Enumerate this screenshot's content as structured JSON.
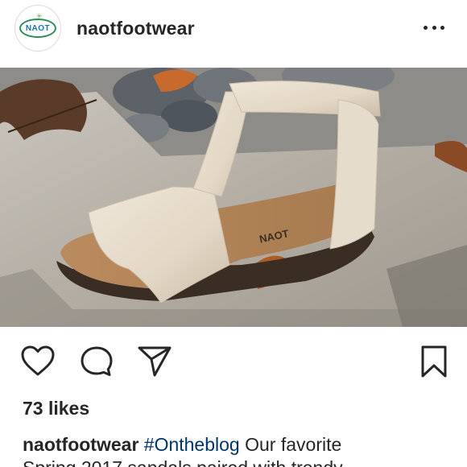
{
  "header": {
    "logo_text": "NAOT",
    "username": "naotfootwear",
    "more_label": "More options"
  },
  "photo": {
    "alt": "Cream leather T-strap sandal on stone",
    "insole_brand_text": "NAOT"
  },
  "actions": {
    "like_icon": "heart-icon",
    "comment_icon": "comment-icon",
    "share_icon": "share-icon",
    "save_icon": "bookmark-icon"
  },
  "likes": {
    "text": "73 likes"
  },
  "caption": {
    "username": "naotfootwear",
    "hashtag": "#Ontheblog",
    "text_line1": " Our favorite",
    "text_line2": "Spring 2017 sandals paired with trendy"
  },
  "colors": {
    "text": "#262626",
    "hashtag": "#003569",
    "logo_green": "#2e8b57",
    "logo_blue": "#1f6fb5"
  }
}
